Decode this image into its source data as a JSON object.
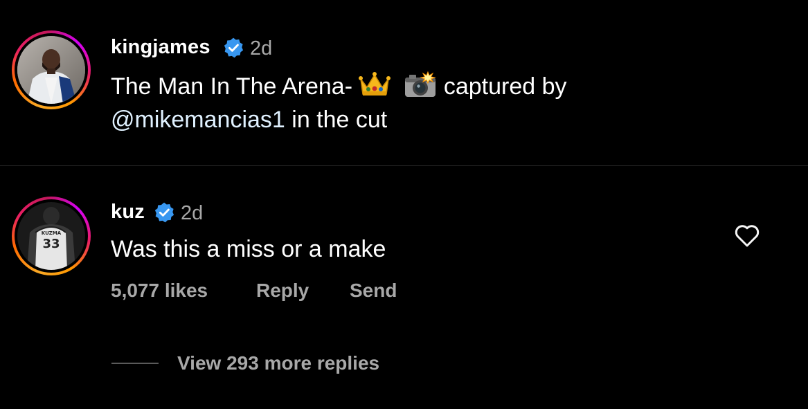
{
  "post": {
    "username": "kingjames",
    "time": "2d",
    "caption_part1": "The Man In The Arena- ",
    "caption_part2": " captured  by",
    "mention": "@mikemancias1",
    "caption_part3": " in the cut",
    "emoji_icons": [
      "crown-icon",
      "camera-flash-icon"
    ]
  },
  "comment": {
    "username": "kuz",
    "time": "2d",
    "text": "Was this a miss or a make",
    "likes": "5,077 likes",
    "reply_label": "Reply",
    "send_label": "Send",
    "view_replies": "View 293 more replies",
    "jersey_name": "KUZMA",
    "jersey_number": "33"
  },
  "colors": {
    "background": "#000000",
    "verified": "#3897f0",
    "secondary_text": "#a8a8a8"
  }
}
